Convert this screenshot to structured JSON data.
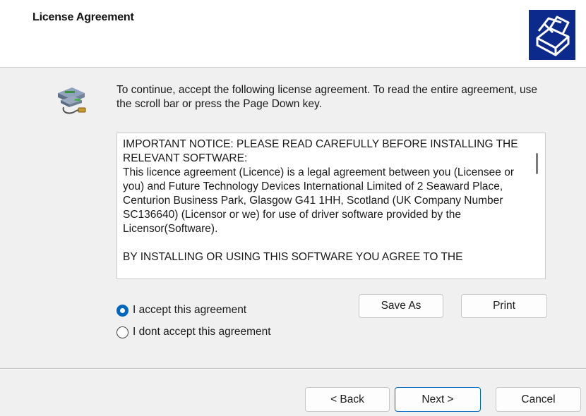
{
  "header": {
    "title": "License Agreement"
  },
  "instructions": "To continue, accept the following license agreement. To read the entire agreement, use the scroll bar or press the Page Down key.",
  "license": {
    "paragraph1": "IMPORTANT NOTICE: PLEASE READ CAREFULLY BEFORE INSTALLING THE RELEVANT SOFTWARE:",
    "paragraph2": "This licence agreement (Licence) is a legal agreement between you (Licensee or you) and Future Technology Devices International Limited of 2 Seaward Place, Centurion Business Park, Glasgow G41 1HH, Scotland (UK Company Number SC136640) (Licensor or we) for use of driver software provided by the Licensor(Software).",
    "paragraph3": "BY INSTALLING OR USING THIS SOFTWARE YOU AGREE TO THE"
  },
  "options": {
    "accept_label": "I accept this agreement",
    "decline_label": "I dont accept this agreement",
    "selected": "accept"
  },
  "buttons": {
    "save_as": "Save As",
    "print": "Print",
    "back": "< Back",
    "next": "Next >",
    "cancel": "Cancel"
  }
}
